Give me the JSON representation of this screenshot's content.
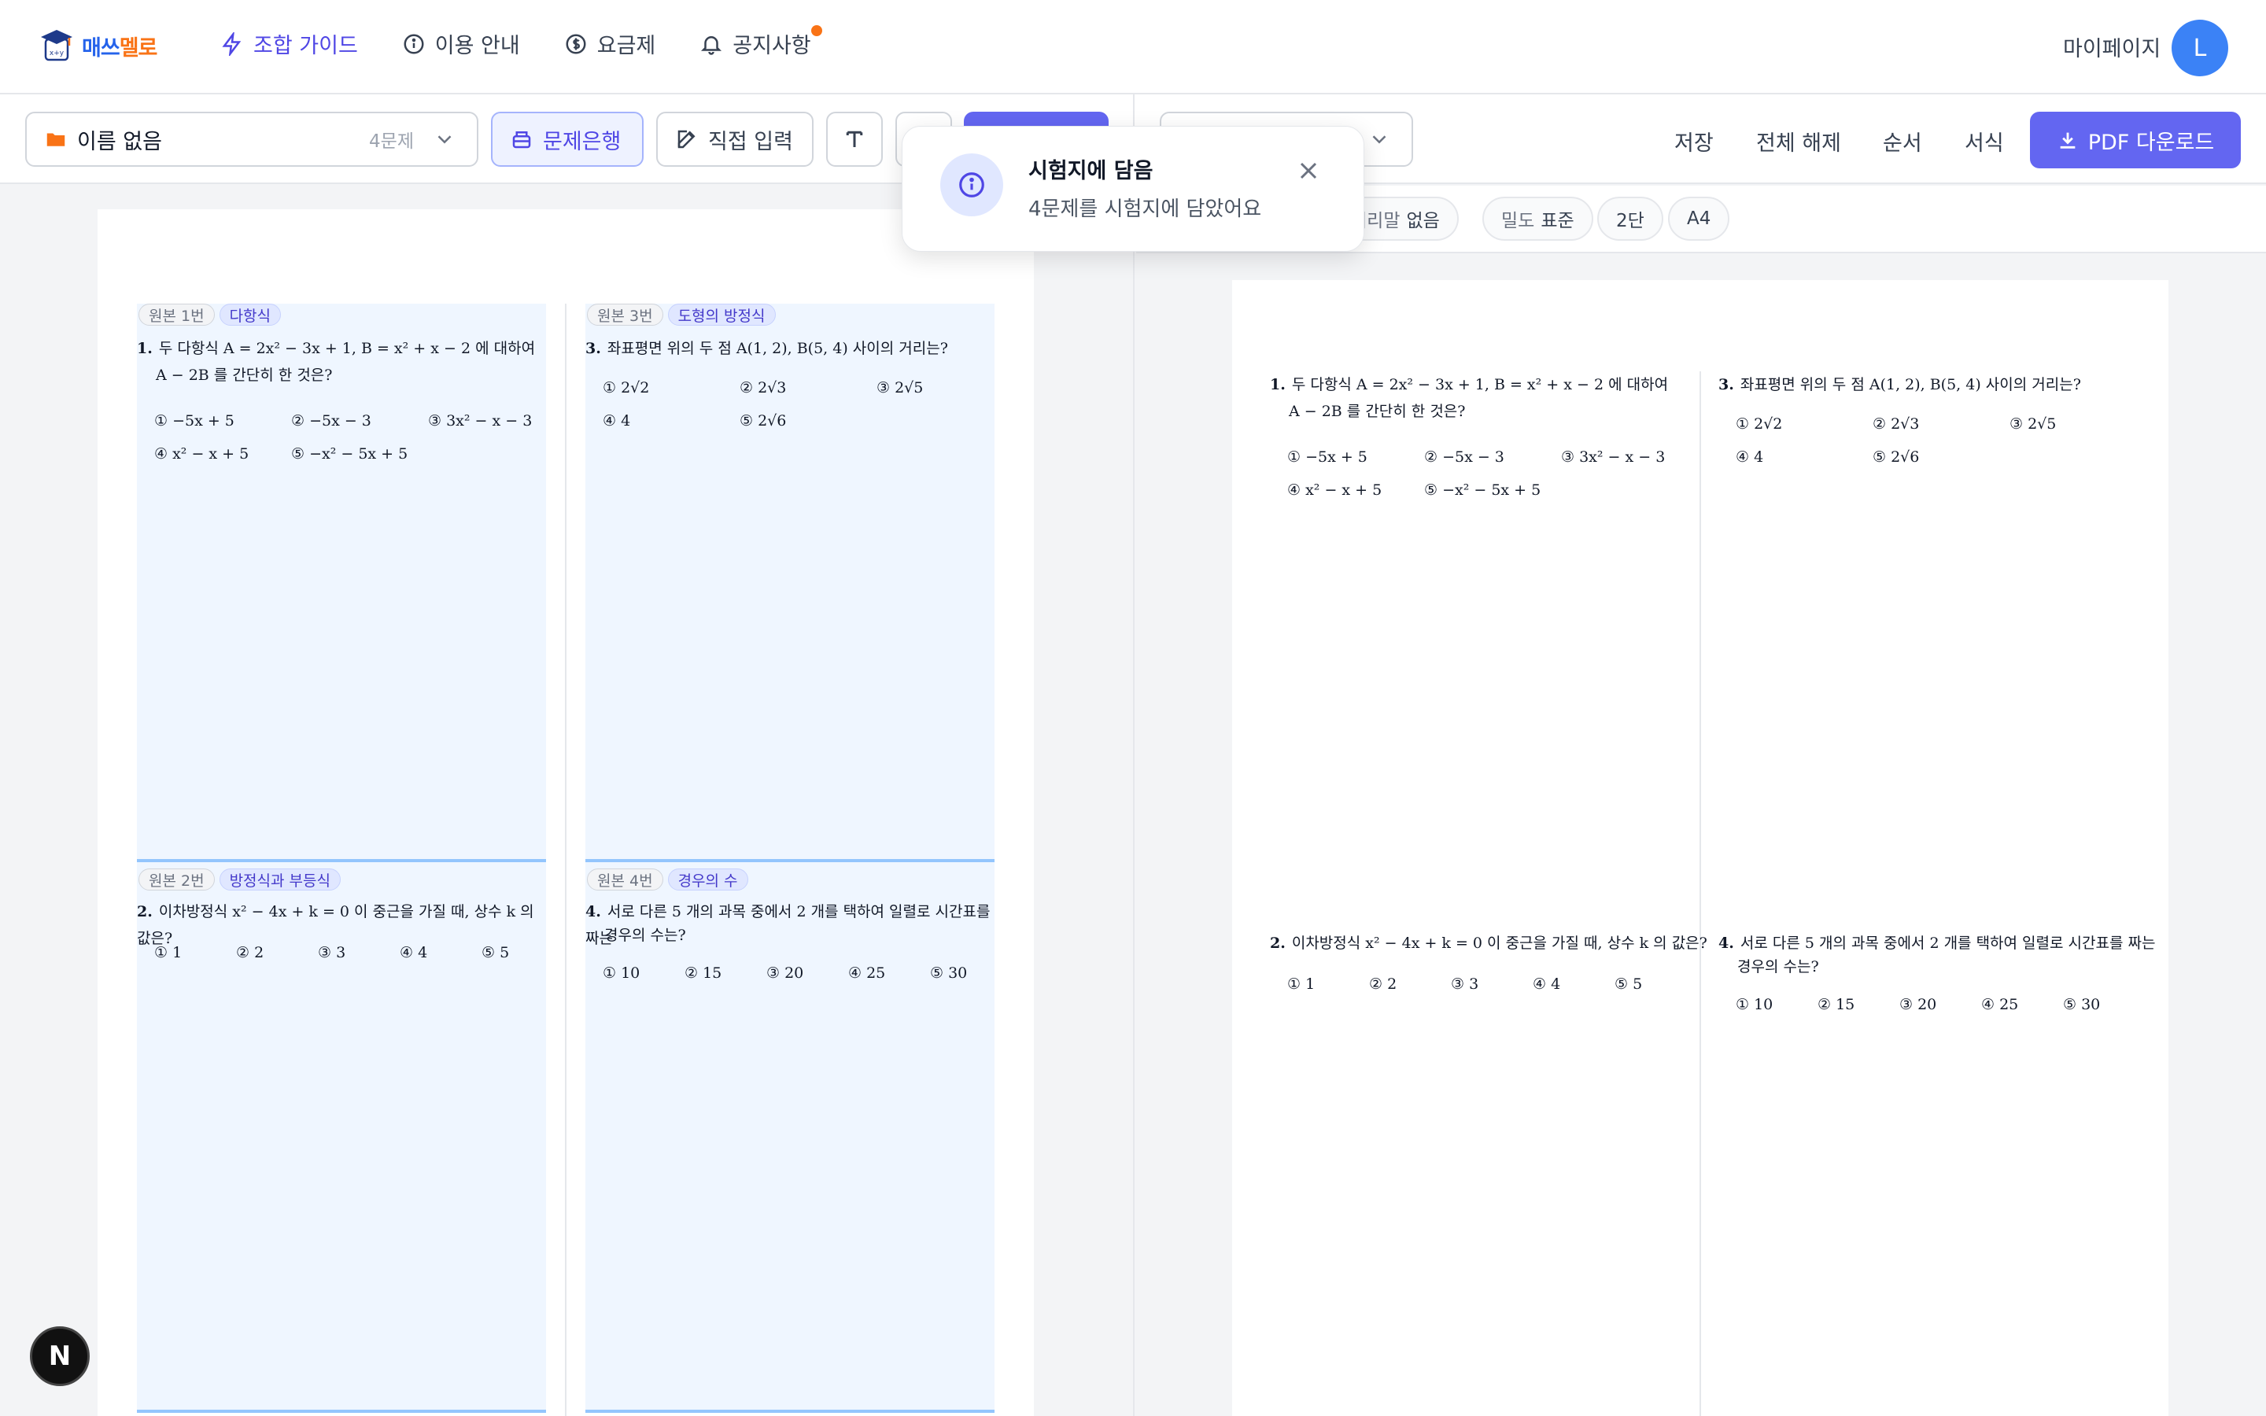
{
  "app": {
    "brand_a": "매쓰",
    "brand_b": "멜로"
  },
  "nav": [
    {
      "label": "조합 가이드",
      "icon": "bolt-icon",
      "active": true
    },
    {
      "label": "이용 안내",
      "icon": "info-icon"
    },
    {
      "label": "요금제",
      "icon": "dollar-icon"
    },
    {
      "label": "공지사항",
      "icon": "bell-icon",
      "has_badge": true
    }
  ],
  "user": {
    "mypage": "마이페이지",
    "initial": "L"
  },
  "toolbar": {
    "folder_name": "이름 없음",
    "folder_count": "4문제",
    "bank_label": "문제은행",
    "direct_label": "직접 입력",
    "save": "저장",
    "clear_all": "전체 해제",
    "order": "순서",
    "format": "서식",
    "pdf": "PDF 다운로드"
  },
  "chips": [
    {
      "key": "머리말",
      "value": "없음"
    },
    {
      "key": "밀도",
      "value": "표준"
    },
    {
      "key": "",
      "value": "2단"
    },
    {
      "key": "",
      "value": "A4"
    }
  ],
  "toast": {
    "title": "시험지에 담음",
    "message": "4문제를 시험지에 담았어요"
  },
  "questions": [
    {
      "orig": "원본 1번",
      "topic": "다항식",
      "num": "1.",
      "text": "두 다항식 A = 2x² − 3x + 1, B = x² + x − 2 에 대하여",
      "text2": "A − 2B 를 간단히 한 것은?",
      "choices": [
        "① −5x + 5",
        "② −5x − 3",
        "③ 3x² − x − 3",
        "④ x² − x + 5",
        "⑤ −x² − 5x + 5"
      ]
    },
    {
      "orig": "원본 3번",
      "topic": "도형의 방정식",
      "num": "3.",
      "text": "좌표평면 위의 두 점 A(1, 2), B(5, 4) 사이의 거리는?",
      "text2": "",
      "choices": [
        "① 2√2",
        "② 2√3",
        "③ 2√5",
        "④ 4",
        "⑤ 2√6"
      ]
    },
    {
      "orig": "원본 2번",
      "topic": "방정식과 부등식",
      "num": "2.",
      "text": "이차방정식 x² − 4x + k = 0 이 중근을 가질 때, 상수 k 의 값은?",
      "text2": "",
      "choices": [
        "① 1",
        "② 2",
        "③ 3",
        "④ 4",
        "⑤ 5"
      ]
    },
    {
      "orig": "원본 4번",
      "topic": "경우의 수",
      "num": "4.",
      "text": "서로 다른 5 개의 과목 중에서 2 개를 택하여 일렬로 시간표를 짜는",
      "text2": "경우의 수는?",
      "choices": [
        "① 10",
        "② 15",
        "③ 20",
        "④ 25",
        "⑤ 30"
      ]
    }
  ],
  "dev": {
    "next_badge": "N"
  }
}
